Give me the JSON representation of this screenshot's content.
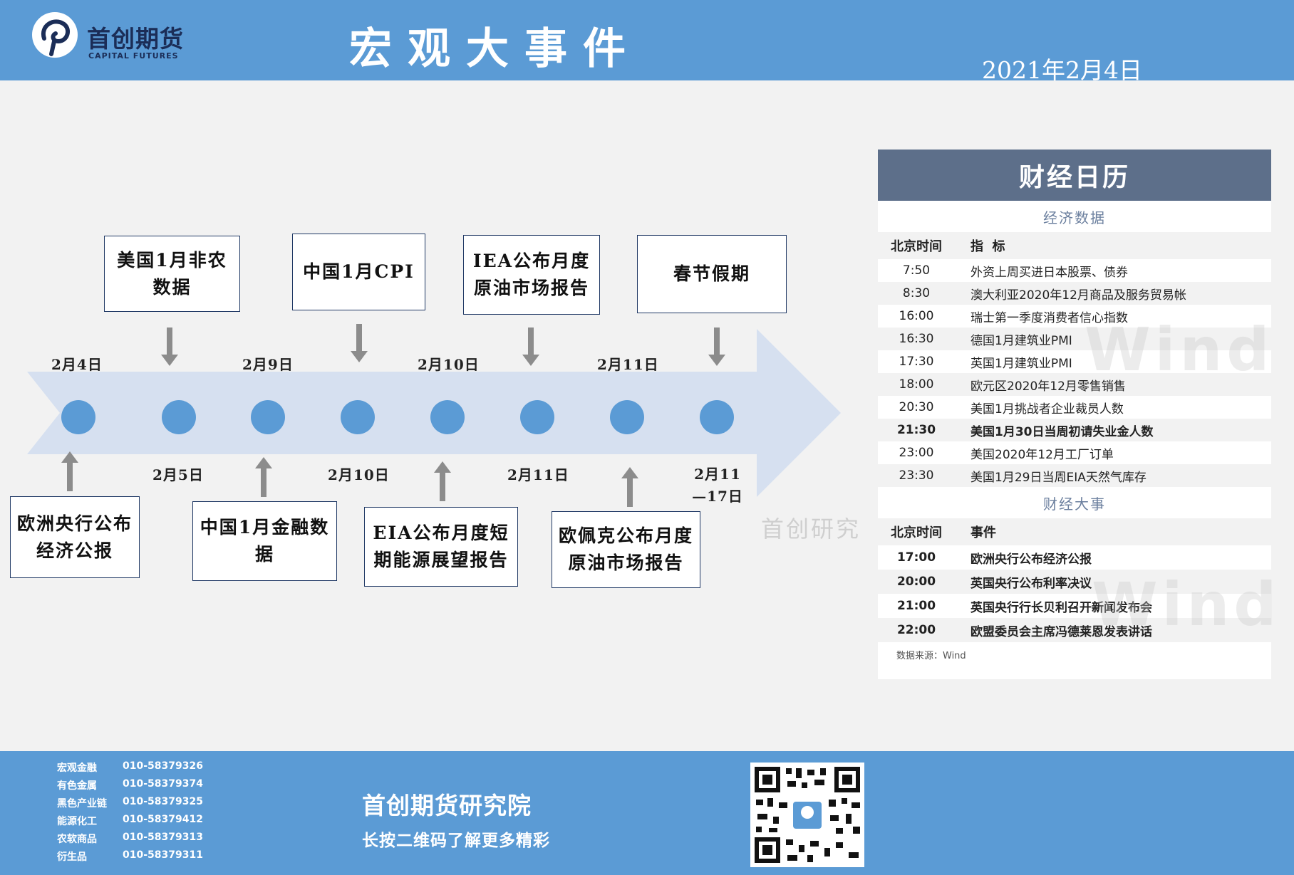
{
  "header": {
    "logo_cn": "首创期货",
    "logo_en": "CAPITAL FUTURES",
    "title": "宏观大事件",
    "date": "2021年2月4日"
  },
  "timeline": {
    "top_events": [
      {
        "label": "美国1月非农数据",
        "date": "2月5日"
      },
      {
        "label": "中国1月CPI",
        "date": "2月10日"
      },
      {
        "label": "IEA公布月度原油市场报告",
        "date": "2月11日"
      },
      {
        "label": "春节假期",
        "date": "2月11—17日"
      }
    ],
    "bottom_events": [
      {
        "label": "欧洲央行公布经济公报",
        "date": "2月4日"
      },
      {
        "label": "中国1月金融数据",
        "date": "2月9日"
      },
      {
        "label": "EIA公布月度短期能源展望报告",
        "date": "2月10日"
      },
      {
        "label": "欧佩克公布月度原油市场报告",
        "date": "2月11日"
      }
    ],
    "watermark": "首创研究"
  },
  "calendar": {
    "title": "财经日历",
    "econ_section_title": "经济数据",
    "econ_headers": {
      "time": "北京时间",
      "item": "指  标"
    },
    "econ_rows": [
      {
        "time": "7:50",
        "item": "外资上周买进日本股票、债券"
      },
      {
        "time": "8:30",
        "item": "澳大利亚2020年12月商品及服务贸易帐"
      },
      {
        "time": "16:00",
        "item": "瑞士第一季度消费者信心指数"
      },
      {
        "time": "16:30",
        "item": "德国1月建筑业PMI"
      },
      {
        "time": "17:30",
        "item": "英国1月建筑业PMI"
      },
      {
        "time": "18:00",
        "item": "欧元区2020年12月零售销售"
      },
      {
        "time": "20:30",
        "item": "美国1月挑战者企业裁员人数"
      },
      {
        "time": "21:30",
        "item": "美国1月30日当周初请失业金人数"
      },
      {
        "time": "23:00",
        "item": "美国2020年12月工厂订单"
      },
      {
        "time": "23:30",
        "item": "美国1月29日当周EIA天然气库存"
      }
    ],
    "events_section_title": "财经大事",
    "events_headers": {
      "time": "北京时间",
      "item": "事件"
    },
    "event_rows": [
      {
        "time": "17:00",
        "item": "欧洲央行公布经济公报"
      },
      {
        "time": "20:00",
        "item": "英国央行公布利率决议"
      },
      {
        "time": "21:00",
        "item": "英国央行行长贝利召开新闻发布会"
      },
      {
        "time": "22:00",
        "item": "欧盟委员会主席冯德莱恩发表讲话"
      }
    ],
    "source": "数据来源：Wind",
    "watermark": "Wind"
  },
  "footer": {
    "contacts": [
      {
        "dept": "宏观金融",
        "phone": "010-58379326"
      },
      {
        "dept": "有色金属",
        "phone": "010-58379374"
      },
      {
        "dept": "黑色产业链",
        "phone": "010-58379325"
      },
      {
        "dept": "能源化工",
        "phone": "010-58379412"
      },
      {
        "dept": "农软商品",
        "phone": "010-58379313"
      },
      {
        "dept": "衍生品",
        "phone": "010-58379311"
      }
    ],
    "institute": "首创期货研究院",
    "qr_caption": "长按二维码了解更多精彩"
  },
  "colors": {
    "header_bg": "#5b9bd5",
    "arrow_fill": "#d6e0f0",
    "dot": "#5b9bd5",
    "panel_head": "#5d6f8a"
  }
}
